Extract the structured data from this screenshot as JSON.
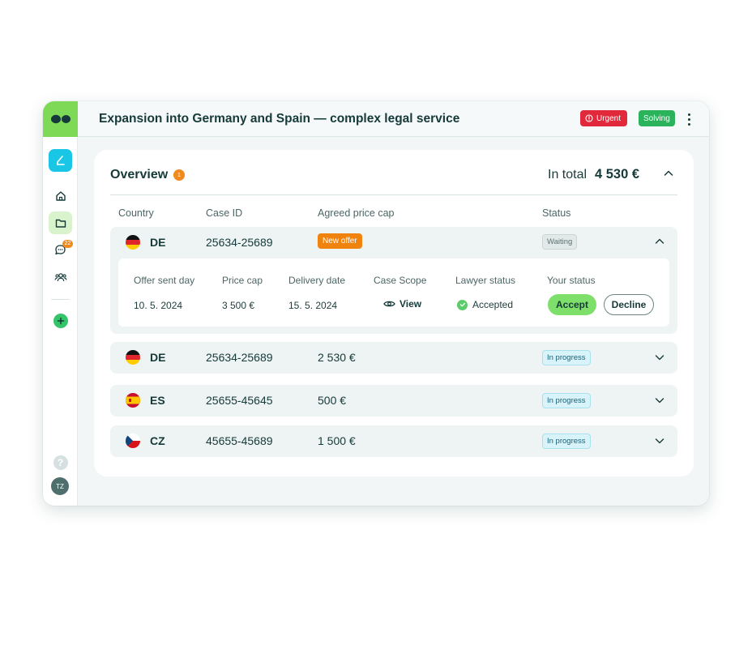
{
  "header": {
    "title": "Expansion into Germany and Spain — complex legal service",
    "urgent_label": "Urgent",
    "solving_label": "Solving"
  },
  "sidebar": {
    "chat_badge": "22",
    "avatar_initials": "TZ",
    "help_label": "?"
  },
  "overview": {
    "title": "Overview",
    "badge": "1",
    "total_label": "In total",
    "total_value": "4 530 €"
  },
  "table": {
    "columns": [
      "Country",
      "Case ID",
      "Agreed price cap",
      "Status"
    ],
    "rows": [
      {
        "country": "DE",
        "case_id": "25634-25689",
        "price": "New offer",
        "status": "Waiting"
      },
      {
        "country": "DE",
        "case_id": "25634-25689",
        "price": "2 530 €",
        "status": "In progress"
      },
      {
        "country": "ES",
        "case_id": "25655-45645",
        "price": "500 €",
        "status": "In progress"
      },
      {
        "country": "CZ",
        "case_id": "45655-45689",
        "price": "1 500 €",
        "status": "In progress"
      }
    ]
  },
  "detail": {
    "headers": [
      "Offer sent day",
      "Price cap",
      "Delivery date",
      "Case Scope",
      "Lawyer status",
      "Your status"
    ],
    "offer_sent_day": "10. 5. 2024",
    "price_cap": "3 500 €",
    "delivery_date": "15. 5. 2024",
    "view_label": "View",
    "lawyer_status": "Accepted",
    "accept_label": "Accept",
    "decline_label": "Decline"
  },
  "colors": {
    "brand_green": "#7ed957",
    "urgent_red": "#e2293b",
    "solving_green": "#2bb35c",
    "offer_orange": "#f0830e",
    "app_cyan": "#19c6e6"
  }
}
